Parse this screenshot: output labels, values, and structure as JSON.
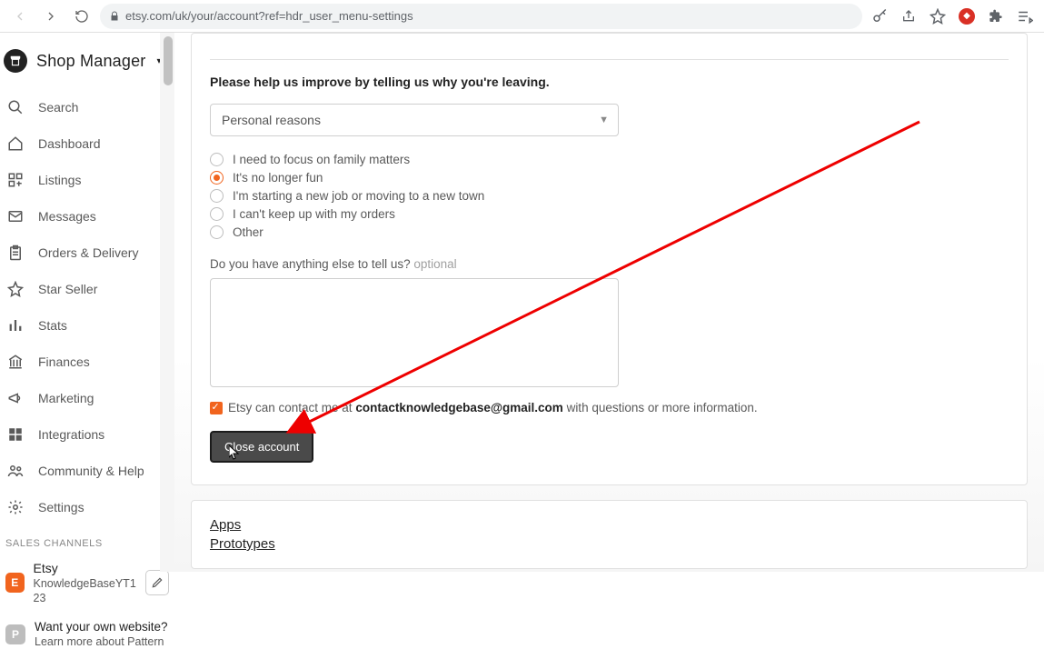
{
  "browser": {
    "url": "etsy.com/uk/your/account?ref=hdr_user_menu-settings"
  },
  "brand": {
    "title": "Shop Manager"
  },
  "nav": {
    "search": "Search",
    "dashboard": "Dashboard",
    "listings": "Listings",
    "messages": "Messages",
    "orders": "Orders & Delivery",
    "star": "Star Seller",
    "stats": "Stats",
    "finances": "Finances",
    "marketing": "Marketing",
    "integrations": "Integrations",
    "community": "Community & Help",
    "settings": "Settings"
  },
  "channels": {
    "header": "SALES CHANNELS",
    "etsy_title": "Etsy",
    "etsy_sub": "KnowledgeBaseYT1 23",
    "pattern_title": "Want your own website?",
    "pattern_sub": "Learn more about Pattern"
  },
  "form": {
    "heading": "Please help us improve by telling us why you're leaving.",
    "select_value": "Personal reasons",
    "radios": [
      "I need to focus on family matters",
      "It's no longer fun",
      "I'm starting a new job or moving to a new town",
      "I can't keep up with my orders",
      "Other"
    ],
    "selected_index": 1,
    "feedback_label": "Do you have anything else to tell us?",
    "feedback_optional": " optional",
    "contact_prefix": "Etsy can contact me at ",
    "contact_email": "contactknowledgebase@gmail.com",
    "contact_suffix": " with questions or more information.",
    "close_button": "Close account"
  },
  "links": {
    "apps": "Apps",
    "prototypes": "Prototypes"
  }
}
